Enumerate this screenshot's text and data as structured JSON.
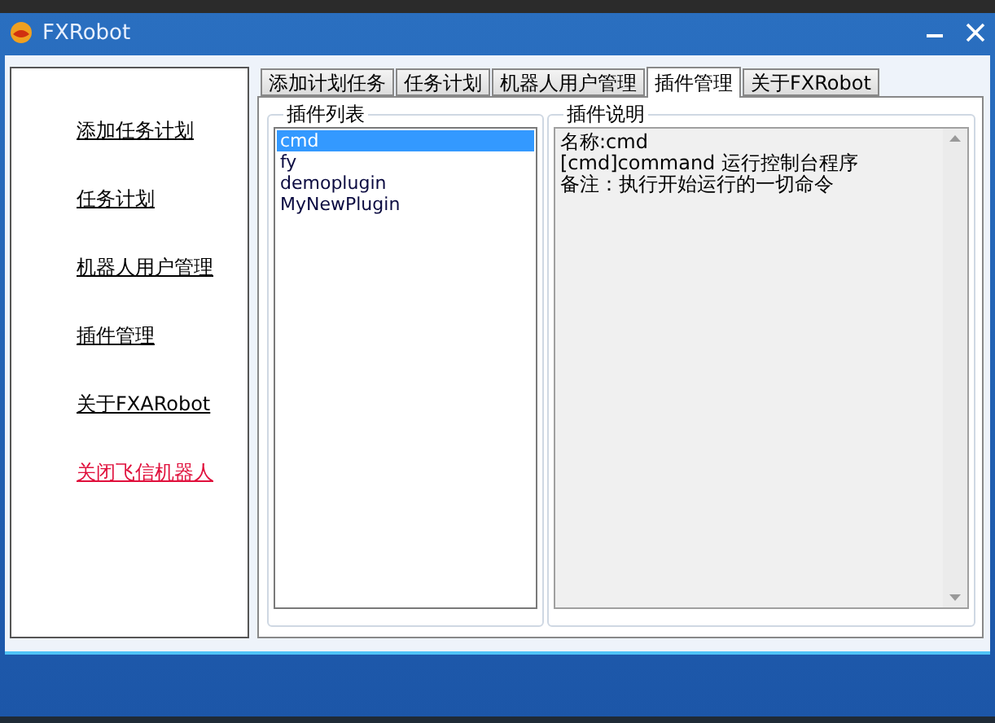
{
  "window": {
    "title": "FXRobot"
  },
  "sidebar": {
    "items": [
      {
        "label": "添加任务计划",
        "kind": "link"
      },
      {
        "label": "任务计划",
        "kind": "link"
      },
      {
        "label": "机器人用户管理",
        "kind": "link"
      },
      {
        "label": "插件管理",
        "kind": "link"
      },
      {
        "label": "关于FXARobot",
        "kind": "link"
      },
      {
        "label": "关闭飞信机器人",
        "kind": "danger"
      }
    ]
  },
  "tabs": [
    {
      "label": "添加计划任务",
      "selected": false
    },
    {
      "label": "任务计划",
      "selected": false
    },
    {
      "label": "机器人用户管理",
      "selected": false
    },
    {
      "label": "插件管理",
      "selected": true
    },
    {
      "label": "关于FXRobot",
      "selected": false
    }
  ],
  "plugin_list": {
    "title": "插件列表",
    "items": [
      {
        "label": "cmd",
        "selected": true
      },
      {
        "label": "fy",
        "selected": false
      },
      {
        "label": "demoplugin",
        "selected": false
      },
      {
        "label": "MyNewPlugin",
        "selected": false
      }
    ]
  },
  "plugin_description": {
    "title": "插件说明",
    "lines": [
      "名称:cmd",
      "[cmd]command 运行控制台程序",
      "备注：执行开始运行的一切命令"
    ]
  }
}
